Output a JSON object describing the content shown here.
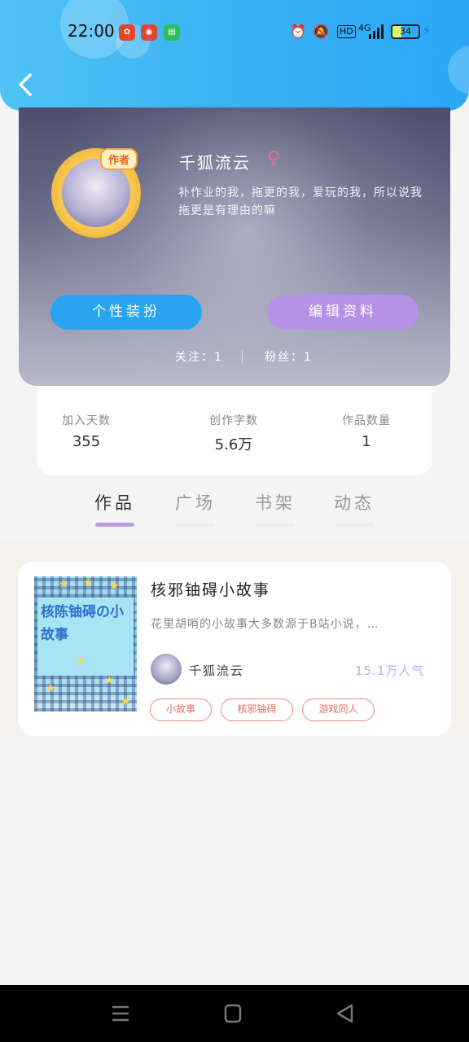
{
  "status_bar": {
    "time": "22:00",
    "battery": "34",
    "network": "4G"
  },
  "profile": {
    "name": "千狐流云",
    "badge": "作者",
    "bio": "补作业的我，拖更的我，爱玩的我，所以说我拖更是有理由的嘛",
    "gender_symbol": "♀",
    "buttons": {
      "dressup": "个性装扮",
      "edit": "编辑资料"
    },
    "following": "关注：1",
    "followers": "粉丝：1"
  },
  "stats": [
    {
      "label": "加入天数",
      "value": "355"
    },
    {
      "label": "创作字数",
      "value": "5.6万"
    },
    {
      "label": "作品数量",
      "value": "1"
    }
  ],
  "tabs": [
    {
      "label": "作品",
      "active": true
    },
    {
      "label": "广场",
      "active": false
    },
    {
      "label": "书架",
      "active": false
    },
    {
      "label": "动态",
      "active": false
    }
  ],
  "book": {
    "title": "核邪铀碍小故事",
    "cover_text": "核陈铀碍の小故事",
    "description": "花里胡哨的小故事大多数源于B站小说，…",
    "author": "千狐流云",
    "popularity": "15.1万人气",
    "tags": [
      "小故事",
      "核邪铀碍",
      "游戏同人"
    ]
  },
  "colors": {
    "header_blue": "#39b0f4",
    "button_blue": "#2aa3f1",
    "button_purple": "#b592e6",
    "tab_active_underline": "#b99be8",
    "tag_border": "#e58a7f"
  },
  "icons": {
    "back": "chevron-left-icon",
    "female": "female-icon",
    "alarm": "alarm-icon",
    "mute": "mute-icon",
    "hd": "hd-icon",
    "signal": "signal-icon",
    "menu": "menu-icon",
    "home": "home-icon",
    "nav_back": "triangle-back-icon"
  }
}
